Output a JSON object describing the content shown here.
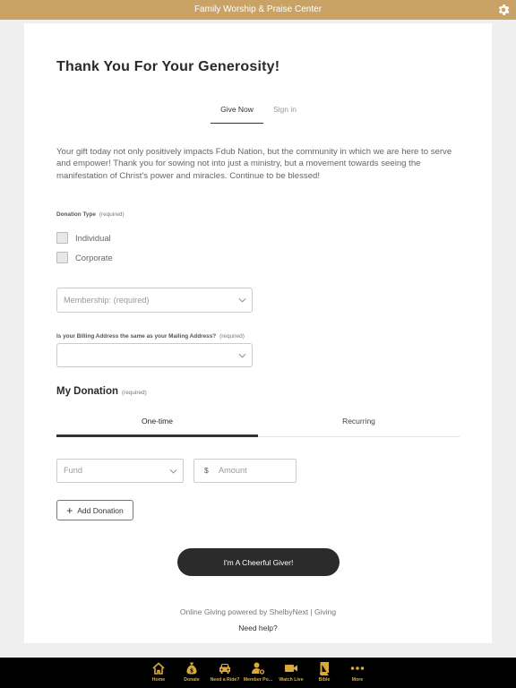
{
  "header": {
    "title": "Family Worship & Praise Center",
    "settings_icon": "gear-icon"
  },
  "page": {
    "title": "Thank You For Your Generosity!",
    "tabs": [
      {
        "label": "Give Now",
        "active": true
      },
      {
        "label": "Sign in",
        "active": false
      }
    ],
    "intro": "Your gift today not only positively impacts Fdub Nation, but the community in which we are here to serve and empower! Thank you for sowing not into just a ministry, but a movement towards seeing the manifestation of Christ's power and miracles. Continue to be blessed!"
  },
  "donation_type": {
    "label": "Donation Type",
    "required": "(required)",
    "options": [
      {
        "label": "Individual",
        "checked": false
      },
      {
        "label": "Corporate",
        "checked": false
      }
    ]
  },
  "membership": {
    "placeholder": "Membership:  (required)"
  },
  "billing": {
    "label": "Is your Billing Address the same as your Mailing Address?",
    "required": "(required)",
    "value": ""
  },
  "my_donation": {
    "title": "My Donation",
    "required": "(required)",
    "tabs": [
      {
        "label": "One-time",
        "active": true
      },
      {
        "label": "Recurring",
        "active": false
      }
    ],
    "fund_placeholder": "Fund",
    "currency": "$",
    "amount_placeholder": "Amount",
    "add_label": "Add Donation"
  },
  "submit_label": "I'm A Cheerful Giver!",
  "footer": {
    "powered": "Online Giving powered by ShelbyNext | Giving",
    "help": "Need help?"
  },
  "bottom_nav": {
    "accent": "#d9a93a",
    "items": [
      {
        "label": "Home",
        "icon": "home-icon"
      },
      {
        "label": "Donate",
        "icon": "money-bag-icon"
      },
      {
        "label": "Need a Ride?",
        "icon": "car-icon"
      },
      {
        "label": "Member Po...",
        "icon": "member-icon"
      },
      {
        "label": "Watch Live",
        "icon": "video-camera-icon"
      },
      {
        "label": "Bible",
        "icon": "bible-icon"
      },
      {
        "label": "More",
        "icon": "more-dots-icon"
      }
    ]
  }
}
